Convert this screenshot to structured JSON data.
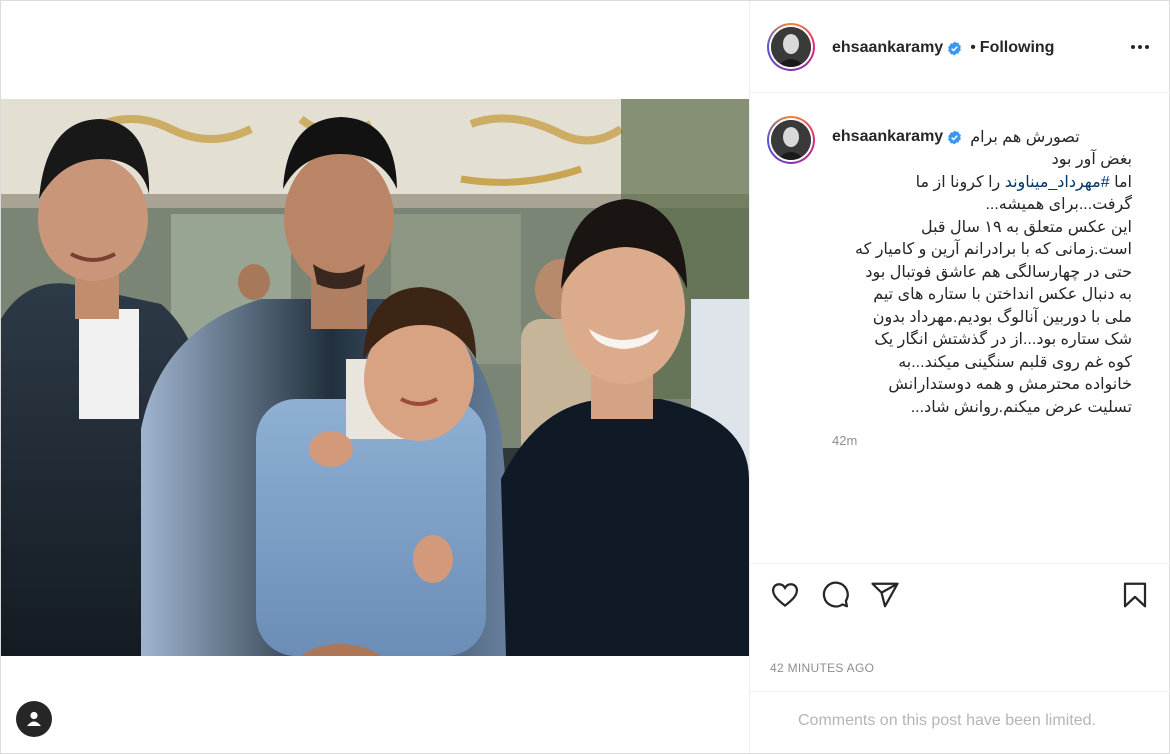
{
  "post": {
    "username": "ehsaankaramy",
    "follow_status": "Following",
    "separator": "•",
    "verified": true
  },
  "caption": {
    "first_line": "تصورش هم برام",
    "lines": [
      "بغض آور بود",
      "اما #مهرداد_میناوند را کرونا از ما",
      "گرفت...برای همیشه...",
      "این عکس متعلق به ۱۹ سال قبل",
      "است.زمانی که با برادرانم آرین و کامیار که",
      "حتی در چهارسالگی هم عاشق فوتبال بود",
      "به دنبال عکس انداختن با ستاره های تیم",
      "ملی با دوربین آنالوگ بودیم.مهرداد بدون",
      "شک ستاره بود...از در گذشتش انگار یک",
      "کوه غم روی قلبم سنگینی میکند...به",
      "خانواده محترمش و همه دوستدارانش",
      "تسلیت عرض میکنم.روانش شاد..."
    ],
    "hashtag": "#مهرداد_میناوند",
    "relative_time": "42m"
  },
  "actions": {
    "like_icon": "heart-icon",
    "comment_icon": "comment-icon",
    "share_icon": "paper-plane-icon",
    "save_icon": "bookmark-icon"
  },
  "timestamp": "42 MINUTES AGO",
  "comments_notice": "Comments on this post have been limited.",
  "colors": {
    "verified_blue": "#3897f0",
    "link_blue": "#00376b",
    "muted_gray": "#8e8e8e"
  }
}
